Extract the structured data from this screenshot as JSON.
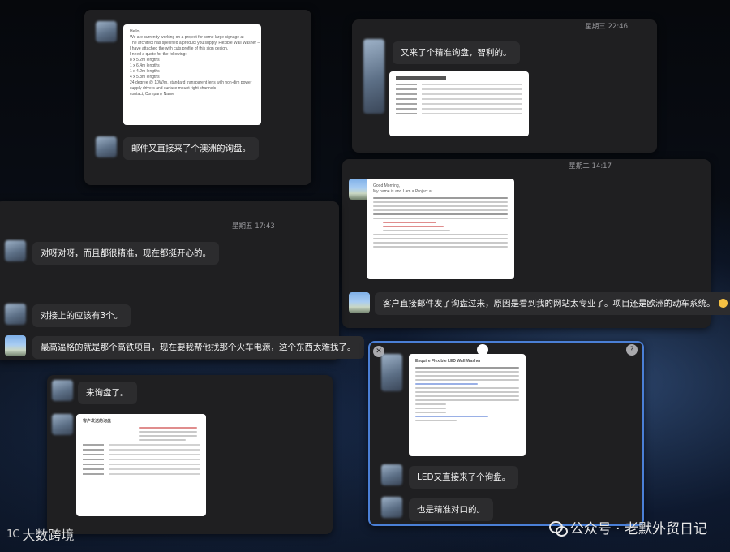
{
  "panel_top_left": {
    "message": "邮件又直接来了个澳洲的询盘。",
    "doc_lines": [
      "Hello,",
      "We are currently working on a project for some large signage at",
      "The architect has specified a product you supply, Flexible Wall Washer –",
      "I have attached the with cuts profile of this sign design.",
      "I need a quote for the following:",
      "8 x 5.2m lengths",
      "1 x 6.4m lengths",
      "1 x 4.2m lengths",
      "4 x 5.8m lengths",
      "24 degree @ 10W/m, standard transparent lens with non-dim power supply drivers and surface mount right channels",
      "contact, Company Name"
    ]
  },
  "panel_top_right": {
    "timestamp": "星期三 22:46",
    "message": "又来了个精准询盘，智利的。"
  },
  "panel_mid_right": {
    "timestamp": "星期二 14:17",
    "message": "客户直接邮件发了询盘过来，原因是看到我的网站太专业了。项目还是欧洲的动车系统。",
    "doc_lines": [
      "Good Morning,",
      "My name is   and I am a Project   at"
    ]
  },
  "panel_mid_left": {
    "timestamp": "星期五 17:43",
    "messages": [
      "对呀对呀，而且都很精准，现在都挺开心的。",
      "对接上的应该有3个。",
      "最高逼格的就是那个高铁项目，现在要我帮他找那个火车电源，这个东西太难找了。"
    ]
  },
  "panel_bottom_left": {
    "message": "来询盘了。",
    "doc_title": "客户发送的询盘"
  },
  "panel_bottom_right": {
    "messages": [
      "LED又直接来了个询盘。",
      "也是精准对口的。"
    ],
    "doc_title": "Enquire Flexible LED Wall Washer"
  },
  "watermark": "公众号 · 老默外贸日记",
  "logo": {
    "mark": "1C",
    "text": "大数跨境"
  },
  "colors": {
    "panel": "#1f1f21",
    "bubble": "#2c2c2e",
    "selection": "#4a7fd6"
  }
}
